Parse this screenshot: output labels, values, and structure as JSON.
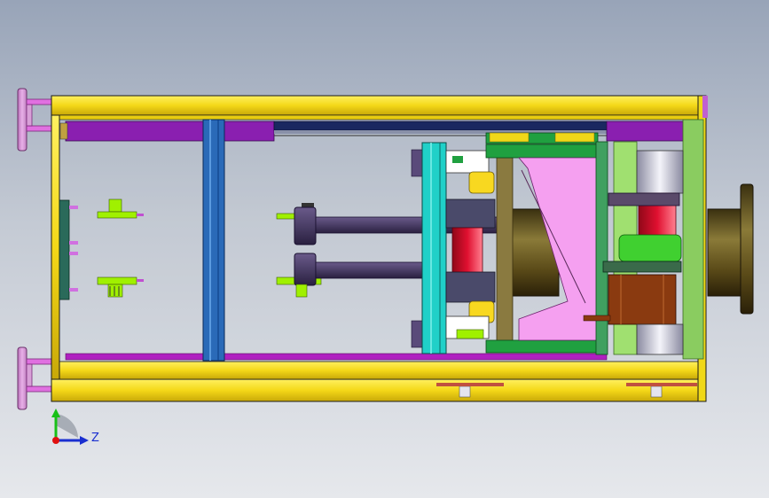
{
  "view": {
    "background_top": "#98a4b8",
    "background_bottom": "#e6e8ec"
  },
  "triad": {
    "z_label": "Z",
    "axis_colors": {
      "x": "#e01010",
      "y": "#18c018",
      "z": "#1a2fd0"
    }
  },
  "colors": {
    "frame_yellow": "#f6e020",
    "frame_outline": "#1a1a1a",
    "rail_purple": "#8a1fb0",
    "column_blue": "#2a6ab8",
    "plate_cyan": "#20d0c8",
    "pink_block": "#f5a0f0",
    "pink_bright": "#f060d8",
    "olive": "#6a5a18",
    "green_plate": "#20a040",
    "light_green": "#a0e070",
    "red_part": "#e01030",
    "dark_slate": "#4a4a6a",
    "lime": "#a0f000",
    "brown_motor": "#8a3a10"
  }
}
